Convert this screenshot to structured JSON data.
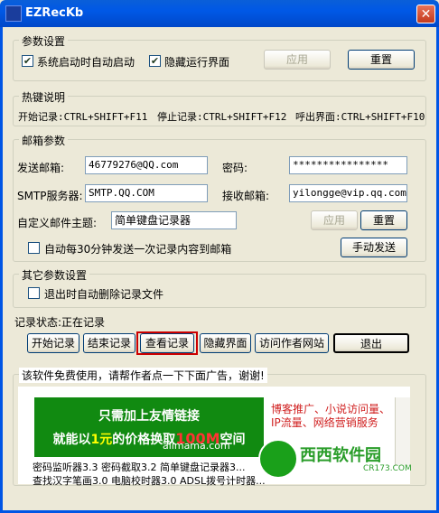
{
  "window": {
    "title": "EZRecKb",
    "close_glyph": "✕"
  },
  "params": {
    "legend": "参数设置",
    "autostart_label": "系统启动时自动启动",
    "hide_label": "隐藏运行界面",
    "apply_label": "应用",
    "reset_label": "重置"
  },
  "hotkeys": {
    "legend": "热键说明",
    "start": "开始记录:CTRL+SHIFT+F11",
    "stop": "停止记录:CTRL+SHIFT+F12",
    "show": "呼出界面:CTRL+SHIFT+F10"
  },
  "email": {
    "legend": "邮箱参数",
    "sender_label": "发送邮箱:",
    "sender_value": "46779276@QQ.com",
    "password_label": "密码:",
    "password_value": "****************",
    "smtp_label": "SMTP服务器:",
    "smtp_value": "SMTP.QQ.COM",
    "receiver_label": "接收邮箱:",
    "receiver_value": "yilongge@vip.qq.com",
    "subject_label": "自定义邮件主题:",
    "subject_value": "简单键盘记录器",
    "apply_label": "应用",
    "reset_label": "重置",
    "auto_send_label": "自动每30分钟发送一次记录内容到邮箱",
    "manual_send_label": "手动发送"
  },
  "other": {
    "legend": "其它参数设置",
    "delete_label": "退出时自动删除记录文件"
  },
  "status": {
    "text": "记录状态:正在记录"
  },
  "actions": {
    "start": "开始记录",
    "stop": "结束记录",
    "view": "查看记录",
    "hide": "隐藏界面",
    "visit": "访问作者网站",
    "exit": "退出"
  },
  "ad": {
    "legend": "该软件免费使用，请帮作者点一下下面广告，谢谢!",
    "banner_line1": "只需加上友情链接",
    "banner_line2_a": "就能以",
    "banner_line2_b": "1元",
    "banner_line2_c": "的价格换取",
    "banner_line2_d": "100M",
    "banner_line2_e": "空间",
    "banner_brand": "alimama.com",
    "right_text": "博客推广、小说访问量、IP流量、网络营销服务",
    "list_line1": "密码监听器3.3 密码截取3.2 简单键盘记录器3...",
    "list_line2": "查找汉字笔画3.0 电脑校时器3.0 ADSL拨号计时器..."
  },
  "watermark": {
    "brand": "西西软件园",
    "url": "CR173.COM"
  }
}
